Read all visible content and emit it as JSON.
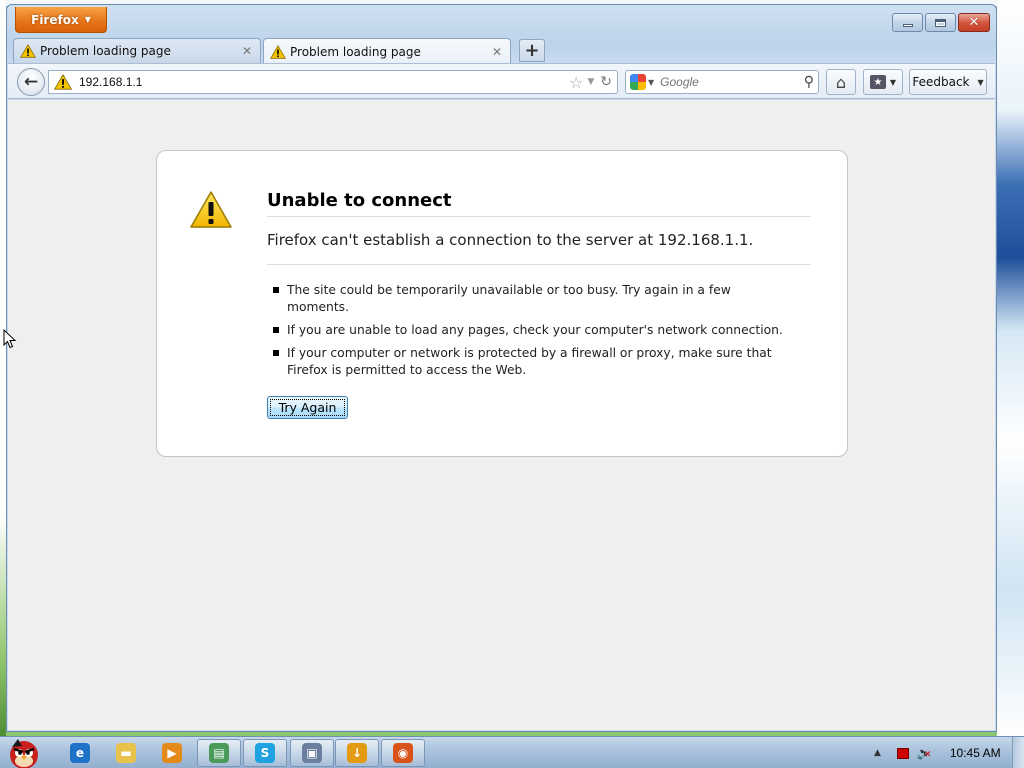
{
  "window": {
    "app_menu_label": "Firefox",
    "controls": {
      "minimize": "minimize",
      "restore": "restore",
      "close": "close"
    }
  },
  "tabs": [
    {
      "title": "Problem loading page",
      "icon": "warning-icon",
      "active": false
    },
    {
      "title": "Problem loading page",
      "icon": "warning-icon",
      "active": true
    }
  ],
  "new_tab_label": "+",
  "navbar": {
    "url": "192.168.1.1",
    "search_placeholder": "Google",
    "feedback_label": "Feedback"
  },
  "error_page": {
    "title": "Unable to connect",
    "description": "Firefox can't establish a connection to the server at 192.168.1.1.",
    "bullets": [
      "The site could be temporarily unavailable or too busy. Try again in a few moments.",
      "If you are unable to load any pages, check your computer's network connection.",
      "If your computer or network is protected by a firewall or proxy, make sure that Firefox is permitted to access the Web."
    ],
    "try_again_label": "Try Again"
  },
  "taskbar": {
    "items": [
      {
        "name": "internet-explorer-icon",
        "color": "#1e73c8",
        "glyph": "e"
      },
      {
        "name": "file-explorer-icon",
        "color": "#e8c24a",
        "glyph": "▬"
      },
      {
        "name": "media-player-icon",
        "color": "#e38a1b",
        "glyph": "▶"
      },
      {
        "name": "app-icon",
        "color": "#4a9a5a",
        "glyph": "▤"
      },
      {
        "name": "skype-icon",
        "color": "#1fa3e0",
        "glyph": "S"
      },
      {
        "name": "network-app-icon",
        "color": "#6a7f9e",
        "glyph": "▣"
      },
      {
        "name": "download-icon",
        "color": "#e39b14",
        "glyph": "↓"
      },
      {
        "name": "firefox-icon",
        "color": "#d9541a",
        "glyph": "◉"
      }
    ],
    "clock": "10:45 AM"
  },
  "colors": {
    "firefox_orange": "#e8761c",
    "content_bg": "#efefef",
    "button_blue": "#3c7fb1"
  }
}
